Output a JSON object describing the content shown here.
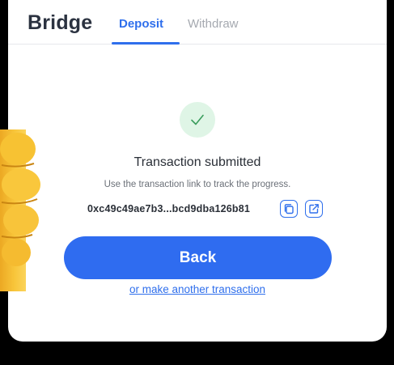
{
  "header": {
    "brand": "Bridge",
    "tabs": [
      {
        "label": "Deposit",
        "active": true
      },
      {
        "label": "Withdraw",
        "active": false
      }
    ]
  },
  "status": {
    "icon": "check-icon",
    "title": "Transaction submitted",
    "subtitle": "Use the transaction link to track the progress."
  },
  "transaction": {
    "hash": "0xc49c49ae7b3...bcd9dba126b81",
    "copy_icon": "copy-icon",
    "open_icon": "external-link-icon"
  },
  "actions": {
    "back_label": "Back",
    "another_label": "or make another transaction"
  },
  "colors": {
    "accent": "#2f6fec",
    "button": "#2f6cf0",
    "success_bg": "#dff5e6",
    "success_check": "#3a9d5d",
    "background": "#000000"
  }
}
